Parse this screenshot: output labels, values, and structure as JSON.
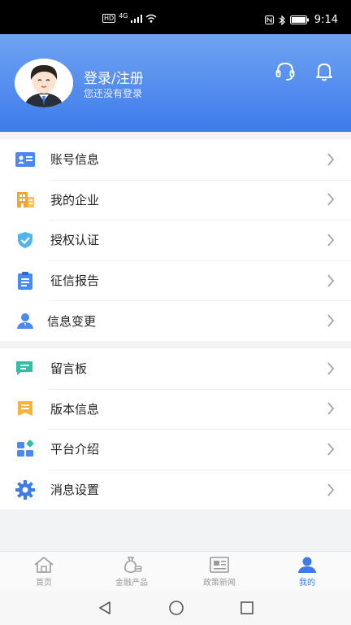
{
  "status_bar": {
    "time": "9:14",
    "network": "4G",
    "hd": "HD"
  },
  "header": {
    "login_title": "登录/注册",
    "login_subtitle": "您还没有登录"
  },
  "menu_group_1": [
    {
      "label": "账号信息",
      "icon": "id-card-icon"
    },
    {
      "label": "我的企业",
      "icon": "building-icon"
    },
    {
      "label": "授权认证",
      "icon": "shield-icon"
    },
    {
      "label": "征信报告",
      "icon": "clipboard-icon"
    },
    {
      "label": "信息变更",
      "icon": "user-edit-icon"
    }
  ],
  "menu_group_2": [
    {
      "label": "留言板",
      "icon": "chat-icon"
    },
    {
      "label": "版本信息",
      "icon": "version-icon"
    },
    {
      "label": "平台介绍",
      "icon": "grid-icon"
    },
    {
      "label": "消息设置",
      "icon": "gear-icon"
    }
  ],
  "bottom_nav": [
    {
      "label": "首页",
      "icon": "home-icon",
      "active": false
    },
    {
      "label": "金融产品",
      "icon": "finance-icon",
      "active": false
    },
    {
      "label": "政策新闻",
      "icon": "news-icon",
      "active": false
    },
    {
      "label": "我的",
      "icon": "profile-icon",
      "active": true
    }
  ],
  "colors": {
    "accent": "#3d7bea",
    "header_top": "#6fa3f2",
    "inactive": "#9a9a9a"
  }
}
